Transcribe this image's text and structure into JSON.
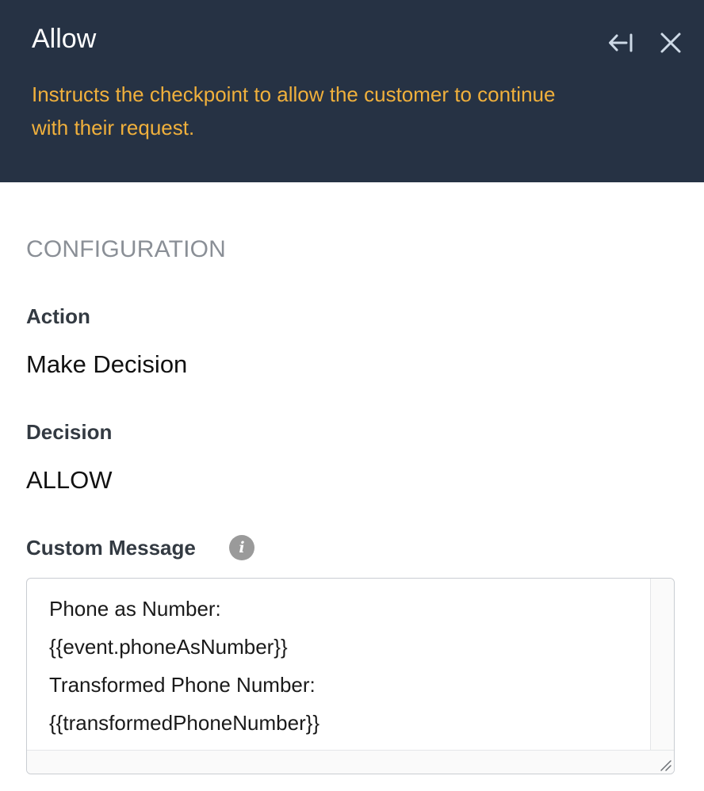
{
  "panel": {
    "title": "Allow",
    "description": "Instructs the checkpoint to allow the customer to continue with their request.",
    "header_bg": "#263244",
    "description_color": "#f0b03c",
    "icons": {
      "collapse": "collapse-left-icon",
      "close": "close-icon"
    }
  },
  "configuration": {
    "heading": "CONFIGURATION",
    "action": {
      "label": "Action",
      "value": "Make Decision"
    },
    "decision": {
      "label": "Decision",
      "value": "ALLOW"
    },
    "custom_message": {
      "label": "Custom Message",
      "info_icon": "info-icon",
      "value": "Phone as Number:\n{{event.phoneAsNumber}}\nTransformed Phone Number:\n{{transformedPhoneNumber}}"
    }
  }
}
